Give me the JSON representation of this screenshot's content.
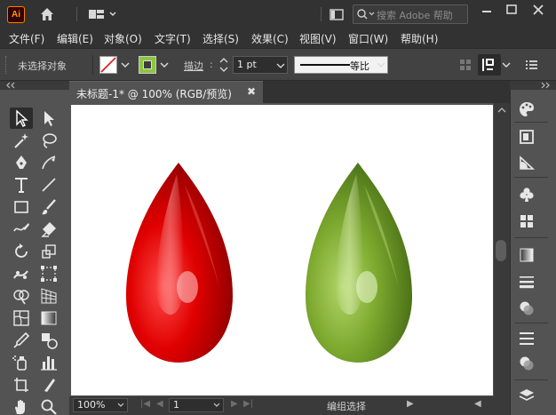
{
  "app": {
    "logo_text": "Ai"
  },
  "search": {
    "placeholder": "搜索 Adobe 帮助"
  },
  "menu": [
    "文件(F)",
    "编辑(E)",
    "对象(O)",
    "文字(T)",
    "选择(S)",
    "效果(C)",
    "视图(V)",
    "窗口(W)",
    "帮助(H)"
  ],
  "control": {
    "selection_status": "未选择对象",
    "stroke_label": "描边",
    "stroke_weight": "1 pt",
    "stroke_style": "等比",
    "fill_color": "#ffffff",
    "stroke_color": "#8dc63f"
  },
  "document": {
    "tab_title": "未标题-1* @ 100% (RGB/预览)",
    "close": "✖"
  },
  "artwork": {
    "drops": [
      {
        "name": "red",
        "base": "#d40000",
        "dark": "#8a0000",
        "light": "#ff6a6a"
      },
      {
        "name": "green",
        "base": "#76a22b",
        "dark": "#3f6312",
        "light": "#c9e58a"
      }
    ]
  },
  "status": {
    "zoom": "100%",
    "artboard_number": "1",
    "tool_name": "编组选择"
  }
}
